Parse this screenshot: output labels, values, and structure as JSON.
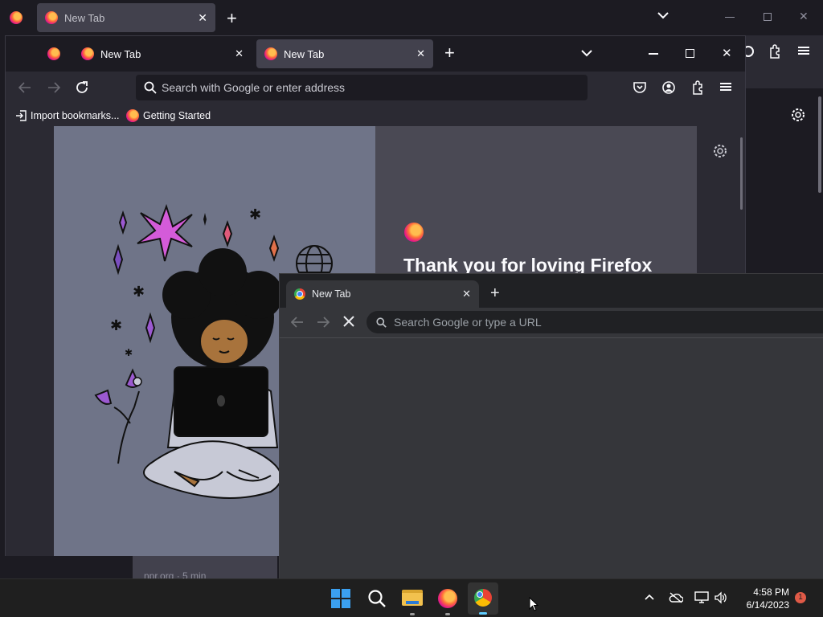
{
  "back_window": {
    "tab_title": "New Tab",
    "new_tab_glyph": "+"
  },
  "firefox": {
    "tabs": [
      {
        "title": "New Tab",
        "active": false
      },
      {
        "title": "New Tab",
        "active": true
      }
    ],
    "address_placeholder": "Search with Google or enter address",
    "bookmarks": [
      {
        "label": "Import bookmarks...",
        "icon": "import-icon"
      },
      {
        "label": "Getting Started",
        "icon": "firefox-icon"
      }
    ],
    "promo_heading": "Thank you for loving Firefox",
    "story_source": "npr.org · 5 min"
  },
  "chrome": {
    "tab_title": "New Tab",
    "address_placeholder": "Search Google or type a URL"
  },
  "taskbar": {
    "time": "4:58 PM",
    "date": "6/14/2023",
    "notification_count": "1"
  },
  "colors": {
    "firefox_frame": "#1c1b22",
    "firefox_toolbar": "#2b2a33",
    "firefox_active_tab": "#42414d",
    "chrome_frame": "#202124",
    "chrome_toolbar": "#35363a",
    "taskbar": "#1f1f1f",
    "illustration_bg": "#6f7488",
    "promo_bg": "#4a4954",
    "notification_badge": "#e05a47"
  }
}
